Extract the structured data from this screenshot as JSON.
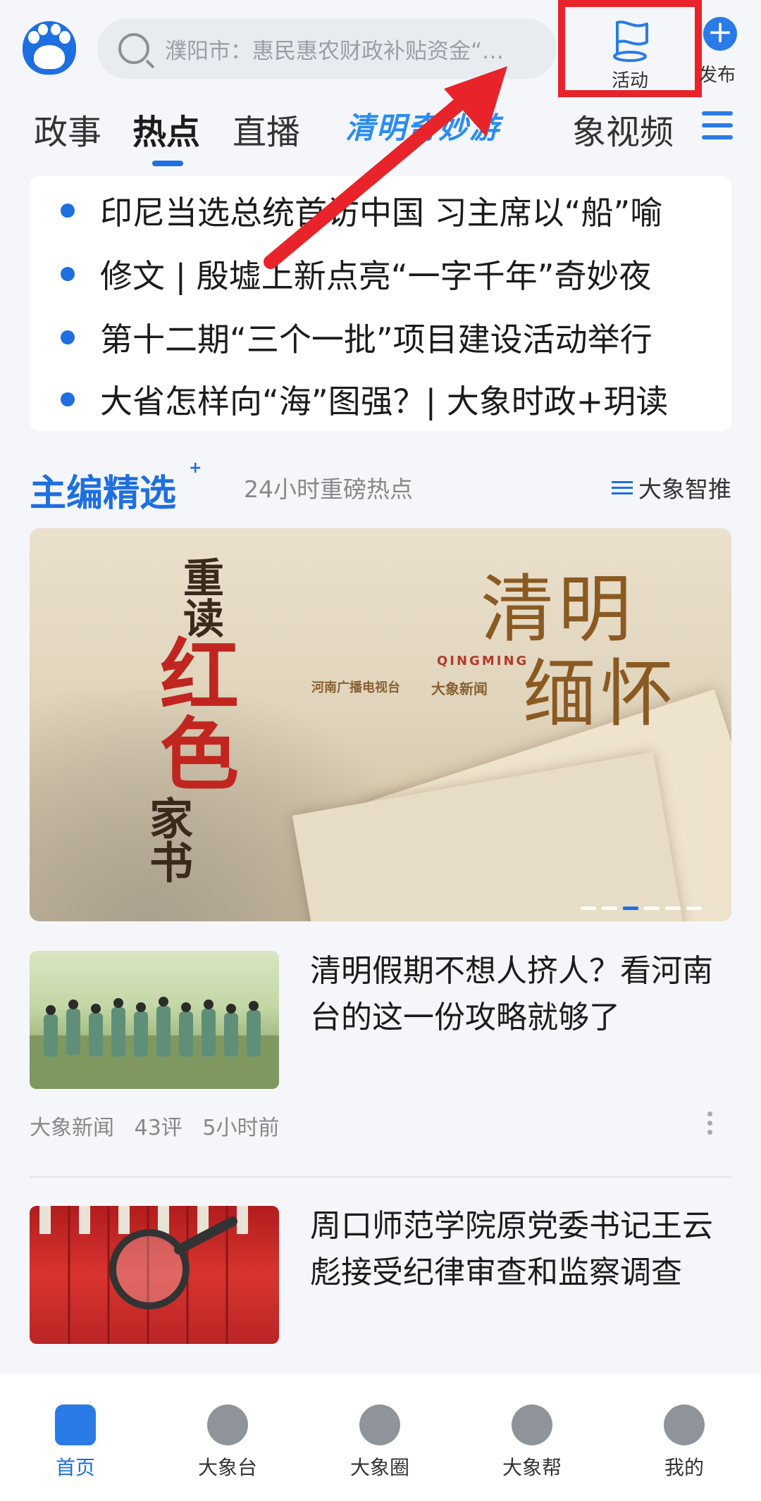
{
  "search": {
    "placeholder": "濮阳市：惠民惠农财政补贴资金“…"
  },
  "header": {
    "activity_label": "活动",
    "publish_label": "发布"
  },
  "tabs": [
    {
      "label": "政事"
    },
    {
      "label": "热点",
      "active": true
    },
    {
      "label": "直播"
    },
    {
      "label": "象视频"
    }
  ],
  "tab_banner": "清明奇妙游",
  "headlines": [
    " 印尼当选总统首访中国 习主席以“船”喻",
    "修文 | 殷墟上新点亮“一字千年”奇妙夜",
    "第十二期“三个一批”项目建设活动举行",
    "大省怎样向“海”图强？| 大象时政+玥读"
  ],
  "section": {
    "title": "主编精选",
    "subtitle": "24小时重磅热点",
    "smart_push": "大象智推"
  },
  "banner": {
    "vertical_1": "重读",
    "vertical_2": "红色",
    "vertical_3": "家书",
    "title_1": "清明",
    "title_2": "缅怀",
    "english": "QINGMING",
    "org_1": "河南广播电视台",
    "org_2": "大象新闻"
  },
  "articles": [
    {
      "title": "清明假期不想人挤人？看河南台的这一份攻略就够了",
      "source": "大象新闻",
      "comments": "43评",
      "time": "5小时前"
    },
    {
      "title": "周口师范学院原党委书记王云彪接受纪律审查和监察调查"
    }
  ],
  "bottom_nav": [
    {
      "label": "首页",
      "active": true
    },
    {
      "label": "大象台"
    },
    {
      "label": "大象圈"
    },
    {
      "label": "大象帮"
    },
    {
      "label": "我的"
    }
  ],
  "colors": {
    "brand": "#1e6fe0",
    "highlight_box": "#e8232a",
    "arrow": "#e8232a"
  }
}
